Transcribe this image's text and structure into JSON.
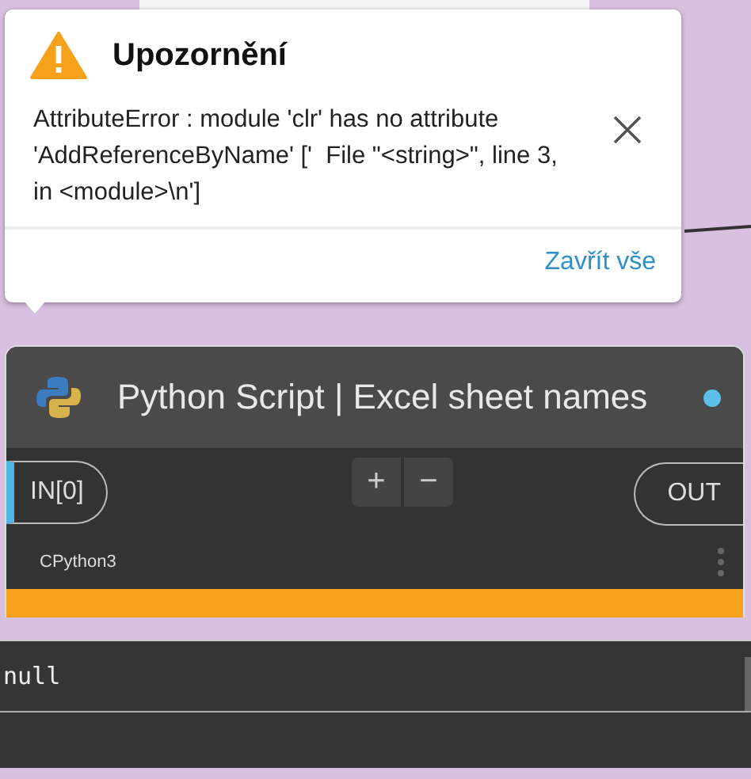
{
  "warning_popup": {
    "title": "Upozornění",
    "message": "AttributeError : module 'clr' has no attribute 'AddReferenceByName' ['  File \"<string>\", line 3, in <module>\\n']",
    "dismiss_all": "Zavřít vše"
  },
  "node": {
    "title": "Python Script | Excel sheet names",
    "inputs": [
      {
        "label": "IN[0]"
      }
    ],
    "add_button": "+",
    "remove_button": "−",
    "outputs": [
      {
        "label": "OUT"
      }
    ],
    "engine": "CPython3",
    "has_warning": true
  },
  "output_preview": {
    "rows": [
      "null"
    ]
  }
}
